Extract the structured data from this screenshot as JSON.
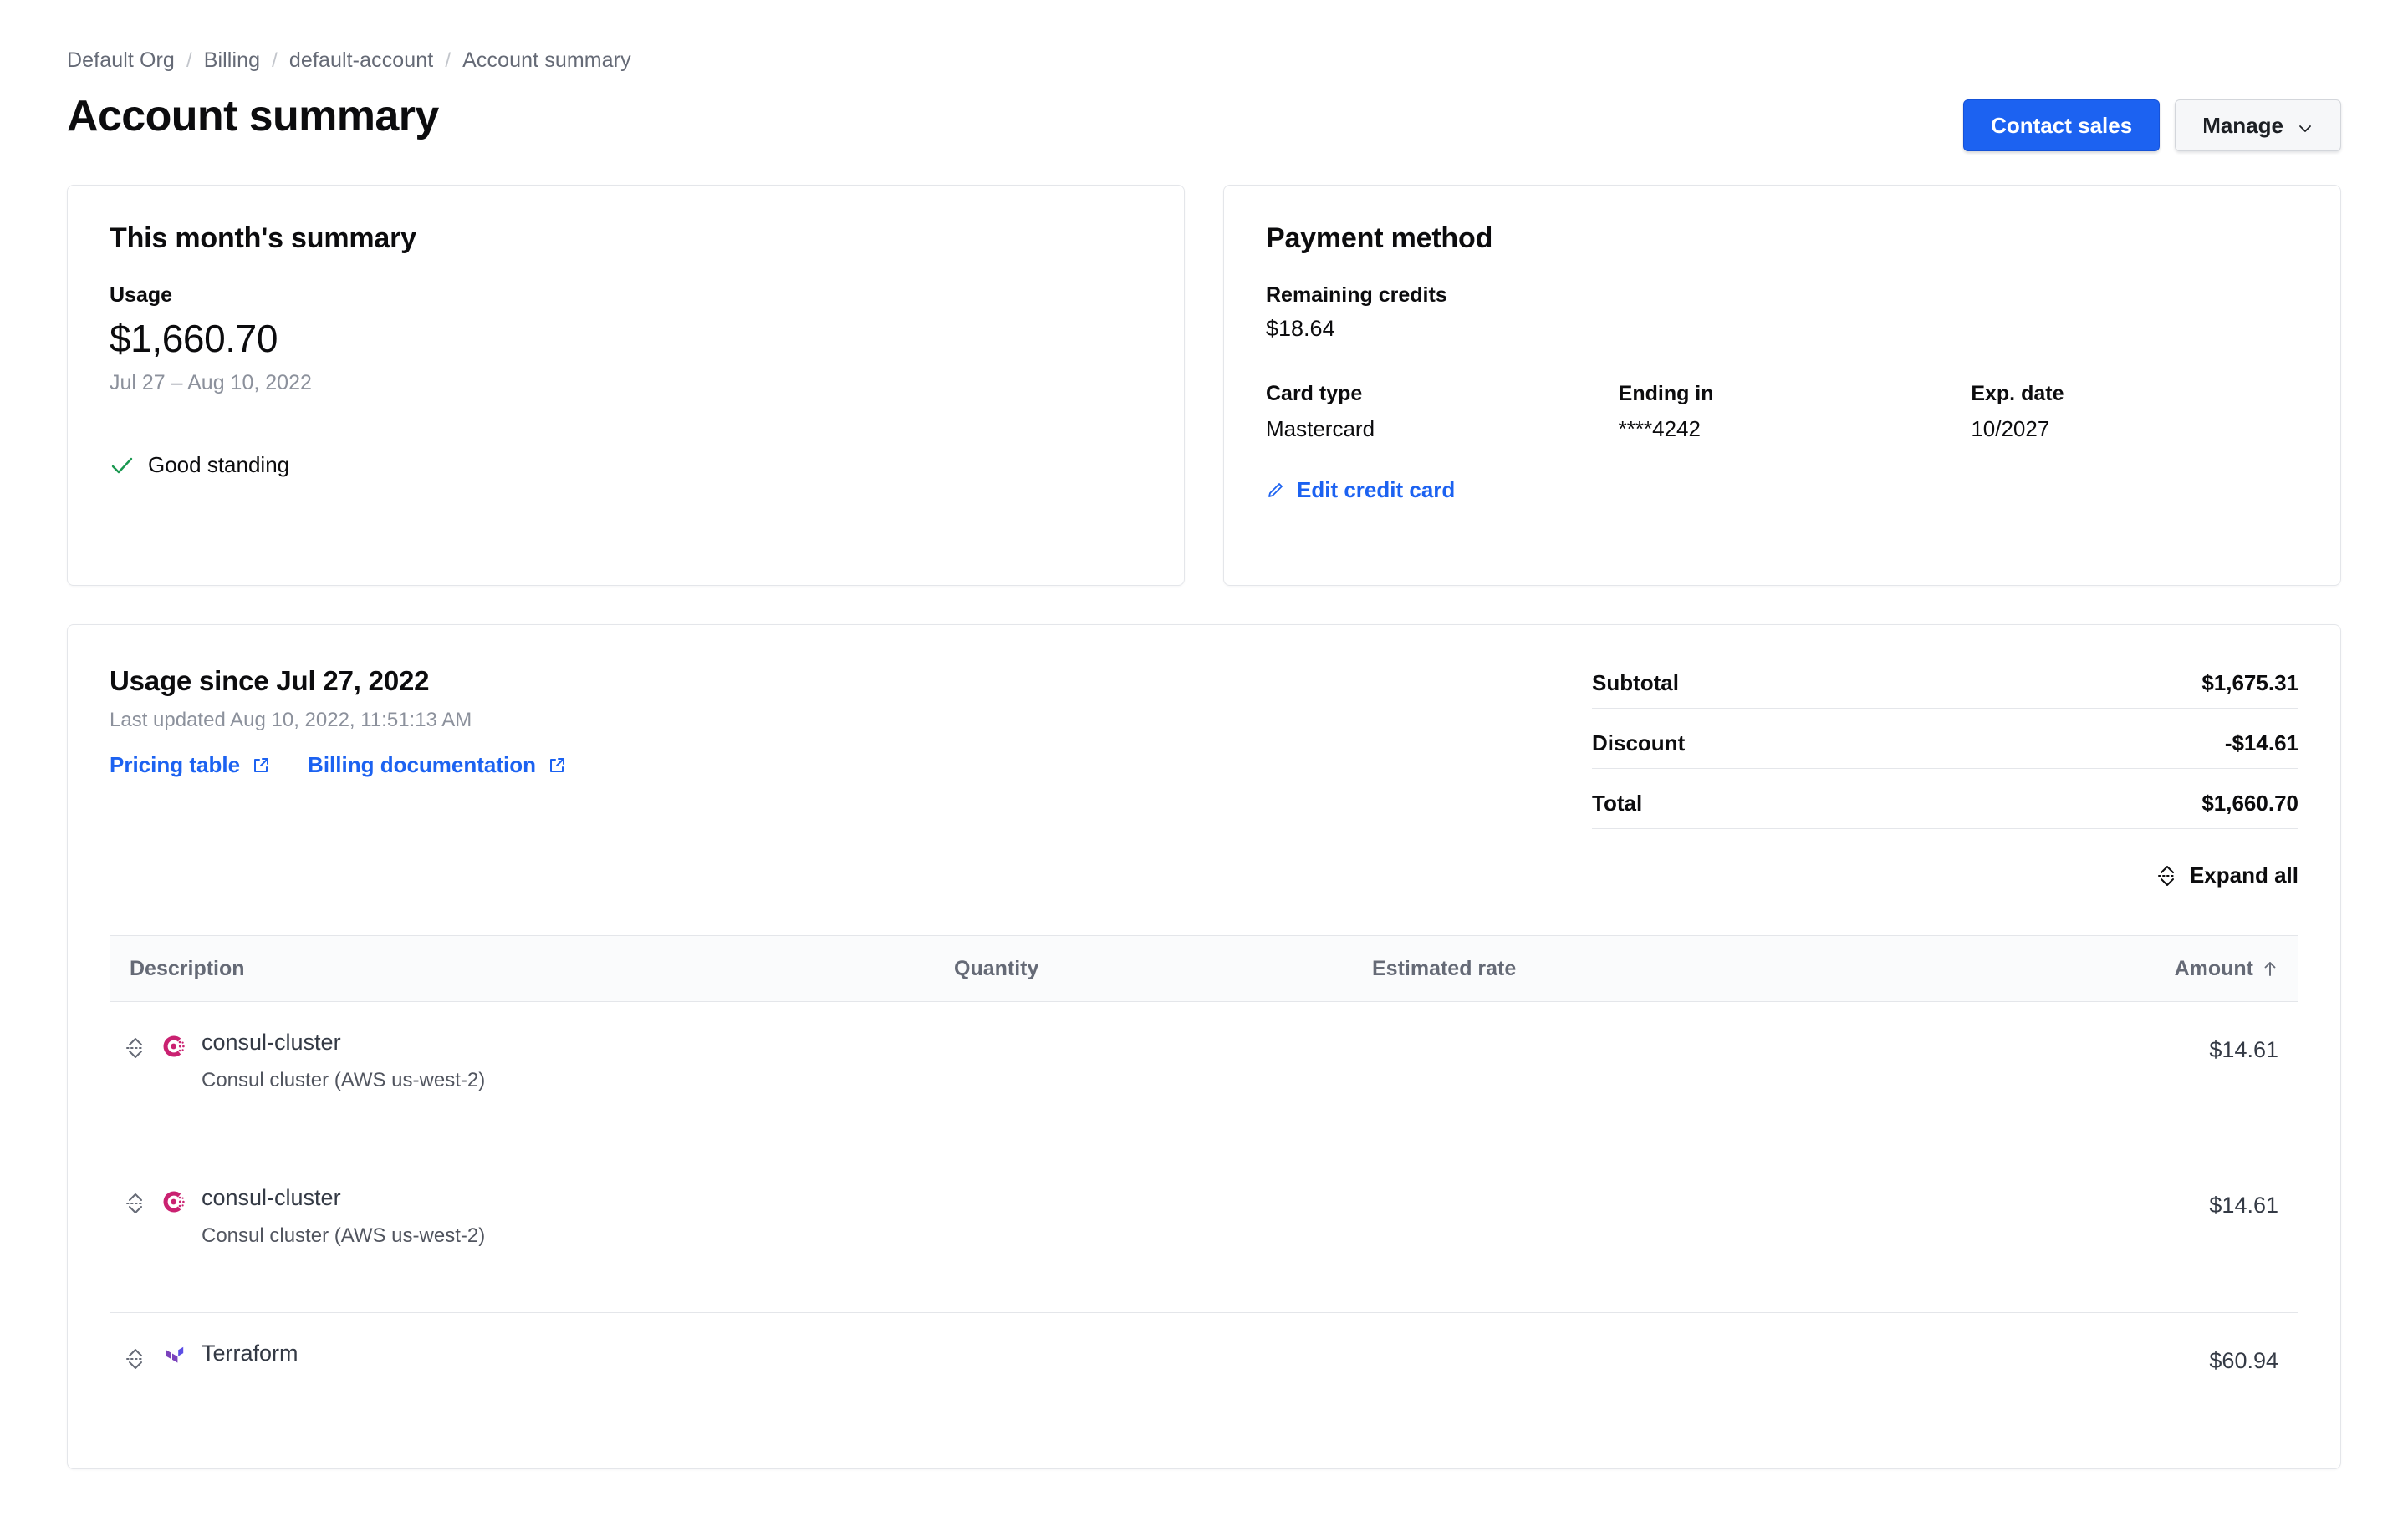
{
  "breadcrumb": {
    "separator": "/",
    "items": [
      {
        "label": "Default Org"
      },
      {
        "label": "Billing"
      },
      {
        "label": "default-account"
      },
      {
        "label": "Account summary"
      }
    ]
  },
  "header": {
    "title": "Account summary",
    "contact_sales_label": "Contact sales",
    "manage_label": "Manage"
  },
  "colors": {
    "primary_blue": "#1c62f1",
    "link_blue": "#1c62f1",
    "success_green": "#1a9850",
    "consul_pink": "#ca2171",
    "terraform_purple": "#7b42bc",
    "border_gray": "#e4e6ea",
    "muted_text": "#8c919c"
  },
  "summary_card": {
    "title": "This month's summary",
    "usage_label": "Usage",
    "usage_amount": "$1,660.70",
    "date_range": "Jul 27 – Aug 10, 2022",
    "standing_label": "Good standing",
    "standing_icon": "check-icon"
  },
  "payment_card": {
    "title": "Payment method",
    "credits_label": "Remaining credits",
    "credits_value": "$18.64",
    "fields": [
      {
        "label": "Card type",
        "value": "Mastercard"
      },
      {
        "label": "Ending in",
        "value": "****4242"
      },
      {
        "label": "Exp. date",
        "value": "10/2027"
      }
    ],
    "edit_link_label": "Edit credit card",
    "edit_link_icon": "pencil-icon"
  },
  "usage_section": {
    "title": "Usage since Jul 27, 2022",
    "last_updated": "Last updated Aug 10, 2022, 11:51:13 AM",
    "links": [
      {
        "label": "Pricing table",
        "icon": "external-link-icon"
      },
      {
        "label": "Billing documentation",
        "icon": "external-link-icon"
      }
    ],
    "totals": [
      {
        "label": "Subtotal",
        "value": "$1,675.31"
      },
      {
        "label": "Discount",
        "value": "-$14.61"
      },
      {
        "label": "Total",
        "value": "$1,660.70"
      }
    ],
    "expand_all_label": "Expand all",
    "expand_all_icon": "expand-collapse-icon",
    "table": {
      "columns": [
        {
          "key": "description",
          "label": "Description"
        },
        {
          "key": "quantity",
          "label": "Quantity"
        },
        {
          "key": "rate",
          "label": "Estimated rate"
        },
        {
          "key": "amount",
          "label": "Amount",
          "sort": "asc",
          "sort_icon": "arrow-up-icon"
        }
      ],
      "rows": [
        {
          "icon": "consul-icon",
          "name": "consul-cluster",
          "sub": "Consul cluster (AWS us-west-2)",
          "quantity": "",
          "rate": "",
          "amount": "$14.61"
        },
        {
          "icon": "consul-icon",
          "name": "consul-cluster",
          "sub": "Consul cluster (AWS us-west-2)",
          "quantity": "",
          "rate": "",
          "amount": "$14.61"
        },
        {
          "icon": "terraform-icon",
          "name": "Terraform",
          "sub": "",
          "quantity": "",
          "rate": "",
          "amount": "$60.94"
        }
      ]
    }
  }
}
